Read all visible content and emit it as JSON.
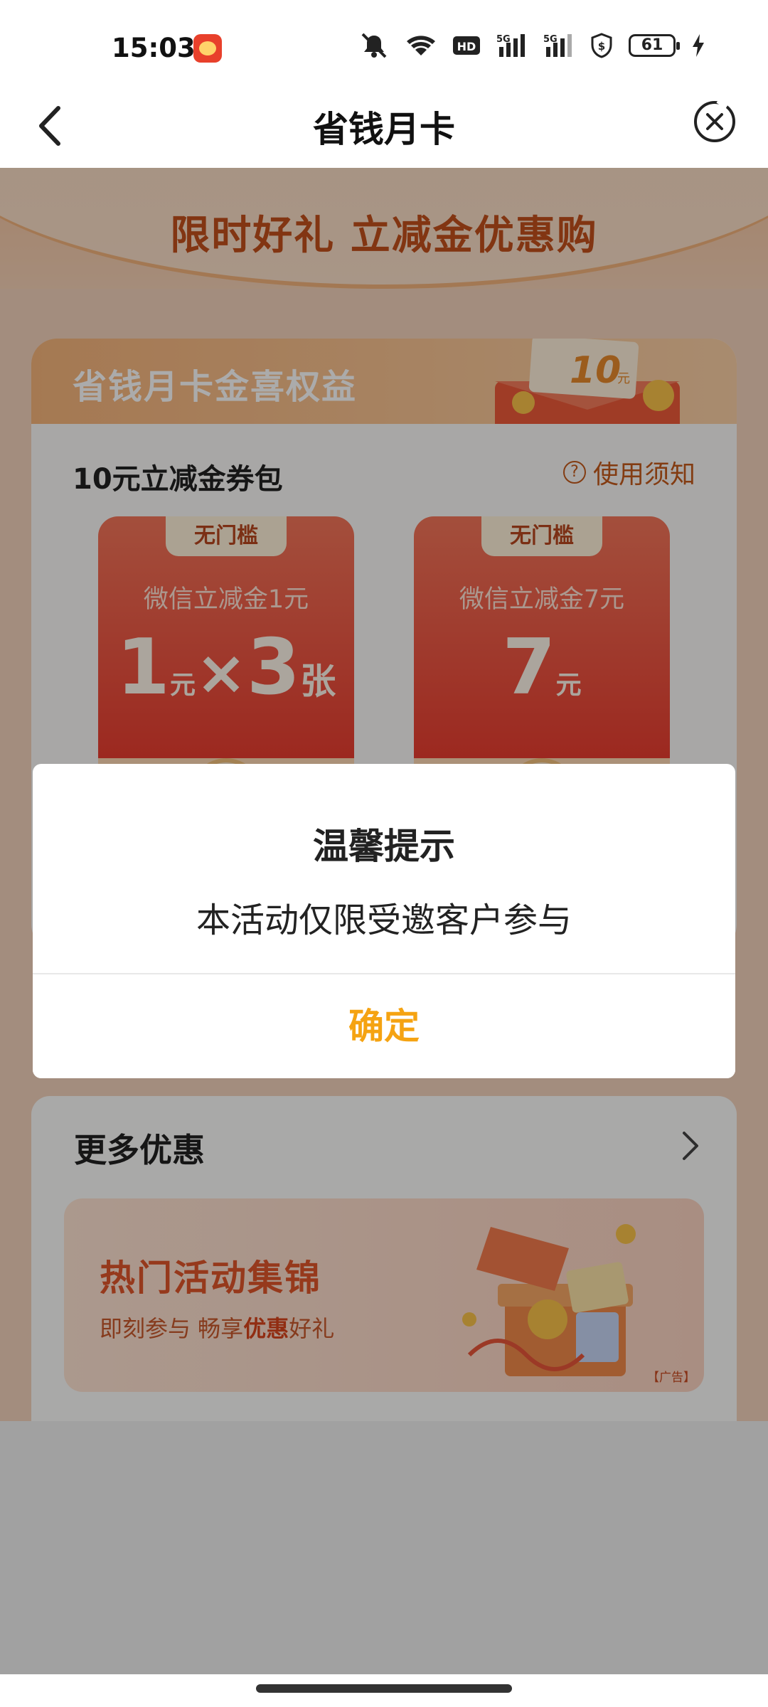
{
  "status_bar": {
    "time": "15:03",
    "battery": "61",
    "icons": [
      "mute-icon",
      "wifi-icon",
      "hd-icon",
      "5g-signal-icon",
      "5g-signal-icon",
      "shield-dollar-icon",
      "battery-icon",
      "charging-icon"
    ]
  },
  "nav": {
    "title": "省钱月卡",
    "back_icon": "back-chevron-icon",
    "close_icon": "close-circle-icon"
  },
  "hero": {
    "subtitle": "限时好礼 立减金优惠购"
  },
  "benefit_card": {
    "header_title": "省钱月卡金喜权益",
    "badge_value": "10",
    "badge_unit": "元",
    "package_title": "10元立减金券包",
    "help_label": "使用须知",
    "coupons": [
      {
        "tag": "无门槛",
        "name": "微信立减金1元",
        "amount": "1",
        "unit": "元",
        "times": "×",
        "count": "3",
        "count_unit": "张"
      },
      {
        "tag": "无门槛",
        "name": "微信立减金7元",
        "amount": "7",
        "unit": "元"
      }
    ]
  },
  "more": {
    "title": "更多优惠",
    "banner_title": "热门活动集锦",
    "banner_sub_prefix": "即刻参与  畅享",
    "banner_sub_bold": "优惠",
    "banner_sub_suffix": "好礼",
    "ad_label": "【广告】"
  },
  "dialog": {
    "title": "温馨提示",
    "message": "本活动仅限受邀客户参与",
    "confirm_label": "确定"
  },
  "colors": {
    "accent": "#f5a312",
    "brand": "#c2501c",
    "coupon_red": "#e8362b"
  }
}
